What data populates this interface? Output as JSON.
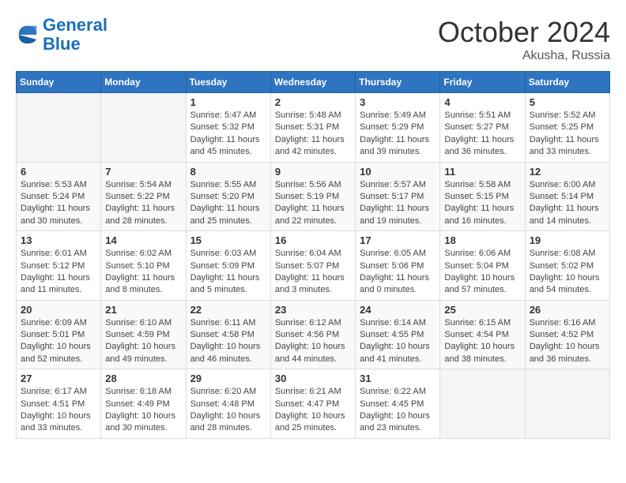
{
  "logo": {
    "line1": "General",
    "line2": "Blue"
  },
  "title": "October 2024",
  "location": "Akusha, Russia",
  "weekdays": [
    "Sunday",
    "Monday",
    "Tuesday",
    "Wednesday",
    "Thursday",
    "Friday",
    "Saturday"
  ],
  "weeks": [
    [
      {
        "day": "",
        "info": ""
      },
      {
        "day": "",
        "info": ""
      },
      {
        "day": "1",
        "info": "Sunrise: 5:47 AM\nSunset: 5:32 PM\nDaylight: 11 hours and 45 minutes."
      },
      {
        "day": "2",
        "info": "Sunrise: 5:48 AM\nSunset: 5:31 PM\nDaylight: 11 hours and 42 minutes."
      },
      {
        "day": "3",
        "info": "Sunrise: 5:49 AM\nSunset: 5:29 PM\nDaylight: 11 hours and 39 minutes."
      },
      {
        "day": "4",
        "info": "Sunrise: 5:51 AM\nSunset: 5:27 PM\nDaylight: 11 hours and 36 minutes."
      },
      {
        "day": "5",
        "info": "Sunrise: 5:52 AM\nSunset: 5:25 PM\nDaylight: 11 hours and 33 minutes."
      }
    ],
    [
      {
        "day": "6",
        "info": "Sunrise: 5:53 AM\nSunset: 5:24 PM\nDaylight: 11 hours and 30 minutes."
      },
      {
        "day": "7",
        "info": "Sunrise: 5:54 AM\nSunset: 5:22 PM\nDaylight: 11 hours and 28 minutes."
      },
      {
        "day": "8",
        "info": "Sunrise: 5:55 AM\nSunset: 5:20 PM\nDaylight: 11 hours and 25 minutes."
      },
      {
        "day": "9",
        "info": "Sunrise: 5:56 AM\nSunset: 5:19 PM\nDaylight: 11 hours and 22 minutes."
      },
      {
        "day": "10",
        "info": "Sunrise: 5:57 AM\nSunset: 5:17 PM\nDaylight: 11 hours and 19 minutes."
      },
      {
        "day": "11",
        "info": "Sunrise: 5:58 AM\nSunset: 5:15 PM\nDaylight: 11 hours and 16 minutes."
      },
      {
        "day": "12",
        "info": "Sunrise: 6:00 AM\nSunset: 5:14 PM\nDaylight: 11 hours and 14 minutes."
      }
    ],
    [
      {
        "day": "13",
        "info": "Sunrise: 6:01 AM\nSunset: 5:12 PM\nDaylight: 11 hours and 11 minutes."
      },
      {
        "day": "14",
        "info": "Sunrise: 6:02 AM\nSunset: 5:10 PM\nDaylight: 11 hours and 8 minutes."
      },
      {
        "day": "15",
        "info": "Sunrise: 6:03 AM\nSunset: 5:09 PM\nDaylight: 11 hours and 5 minutes."
      },
      {
        "day": "16",
        "info": "Sunrise: 6:04 AM\nSunset: 5:07 PM\nDaylight: 11 hours and 3 minutes."
      },
      {
        "day": "17",
        "info": "Sunrise: 6:05 AM\nSunset: 5:06 PM\nDaylight: 11 hours and 0 minutes."
      },
      {
        "day": "18",
        "info": "Sunrise: 6:06 AM\nSunset: 5:04 PM\nDaylight: 10 hours and 57 minutes."
      },
      {
        "day": "19",
        "info": "Sunrise: 6:08 AM\nSunset: 5:02 PM\nDaylight: 10 hours and 54 minutes."
      }
    ],
    [
      {
        "day": "20",
        "info": "Sunrise: 6:09 AM\nSunset: 5:01 PM\nDaylight: 10 hours and 52 minutes."
      },
      {
        "day": "21",
        "info": "Sunrise: 6:10 AM\nSunset: 4:59 PM\nDaylight: 10 hours and 49 minutes."
      },
      {
        "day": "22",
        "info": "Sunrise: 6:11 AM\nSunset: 4:58 PM\nDaylight: 10 hours and 46 minutes."
      },
      {
        "day": "23",
        "info": "Sunrise: 6:12 AM\nSunset: 4:56 PM\nDaylight: 10 hours and 44 minutes."
      },
      {
        "day": "24",
        "info": "Sunrise: 6:14 AM\nSunset: 4:55 PM\nDaylight: 10 hours and 41 minutes."
      },
      {
        "day": "25",
        "info": "Sunrise: 6:15 AM\nSunset: 4:54 PM\nDaylight: 10 hours and 38 minutes."
      },
      {
        "day": "26",
        "info": "Sunrise: 6:16 AM\nSunset: 4:52 PM\nDaylight: 10 hours and 36 minutes."
      }
    ],
    [
      {
        "day": "27",
        "info": "Sunrise: 6:17 AM\nSunset: 4:51 PM\nDaylight: 10 hours and 33 minutes."
      },
      {
        "day": "28",
        "info": "Sunrise: 6:18 AM\nSunset: 4:49 PM\nDaylight: 10 hours and 30 minutes."
      },
      {
        "day": "29",
        "info": "Sunrise: 6:20 AM\nSunset: 4:48 PM\nDaylight: 10 hours and 28 minutes."
      },
      {
        "day": "30",
        "info": "Sunrise: 6:21 AM\nSunset: 4:47 PM\nDaylight: 10 hours and 25 minutes."
      },
      {
        "day": "31",
        "info": "Sunrise: 6:22 AM\nSunset: 4:45 PM\nDaylight: 10 hours and 23 minutes."
      },
      {
        "day": "",
        "info": ""
      },
      {
        "day": "",
        "info": ""
      }
    ]
  ]
}
